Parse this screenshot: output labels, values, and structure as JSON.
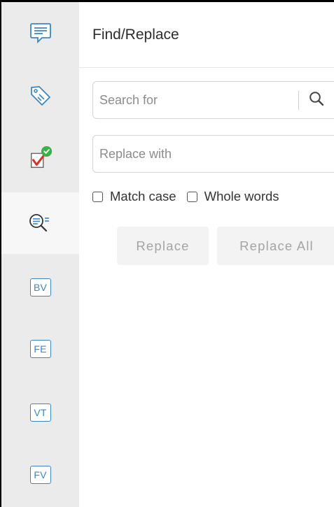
{
  "sidebar": {
    "items": [
      {
        "name": "comments",
        "icon": "speech-bubble-icon"
      },
      {
        "name": "tags",
        "icon": "tag-icon"
      },
      {
        "name": "review",
        "icon": "checklist-icon",
        "badge_color": "#37b34a",
        "check_color": "#d9302c"
      },
      {
        "name": "find-replace",
        "icon": "find-replace-icon",
        "active": true
      },
      {
        "name": "bv",
        "label": "BV"
      },
      {
        "name": "fe",
        "label": "FE"
      },
      {
        "name": "vt",
        "label": "VT"
      },
      {
        "name": "fv",
        "label": "FV"
      }
    ],
    "accent_color": "#3d86c6"
  },
  "panel": {
    "title": "Find/Replace",
    "search": {
      "placeholder": "Search for",
      "value": ""
    },
    "replace": {
      "placeholder": "Replace with",
      "value": ""
    },
    "options": {
      "match_case": {
        "label": "Match case",
        "checked": false
      },
      "whole_words": {
        "label": "Whole words",
        "checked": false
      }
    },
    "buttons": {
      "replace": "Replace",
      "replace_all": "Replace All"
    }
  }
}
